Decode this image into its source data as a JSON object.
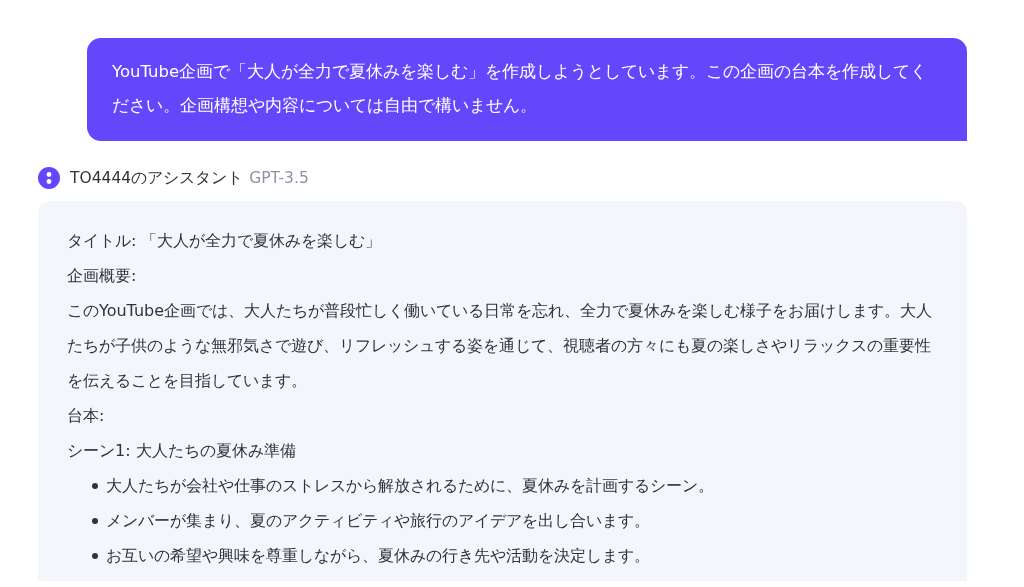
{
  "user_message": {
    "text": "YouTube企画で「大人が全力で夏休みを楽しむ」を作成しようとしています。この企画の台本を作成してください。企画構想や内容については自由で構いません。"
  },
  "assistant": {
    "name": "TO4444のアシスタント",
    "model": "GPT-3.5",
    "blocks": [
      {
        "kind": "line",
        "text": "タイトル: 「大人が全力で夏休みを楽しむ」"
      },
      {
        "kind": "line",
        "text": "企画概要:"
      },
      {
        "kind": "line",
        "text": "このYouTube企画では、大人たちが普段忙しく働いている日常を忘れ、全力で夏休みを楽しむ様子をお届けします。大人たちが子供のような無邪気さで遊び、リフレッシュする姿を通じて、視聴者の方々にも夏の楽しさやリラックスの重要性を伝えることを目指しています。"
      },
      {
        "kind": "line",
        "text": "台本:"
      },
      {
        "kind": "line",
        "text": "シーン1: 大人たちの夏休み準備"
      },
      {
        "kind": "bullets",
        "items": [
          "大人たちが会社や仕事のストレスから解放されるために、夏休みを計画するシーン。",
          "メンバーが集まり、夏のアクティビティや旅行のアイデアを出し合います。",
          "お互いの希望や興味を尊重しながら、夏休みの行き先や活動を決定します。"
        ]
      }
    ]
  }
}
